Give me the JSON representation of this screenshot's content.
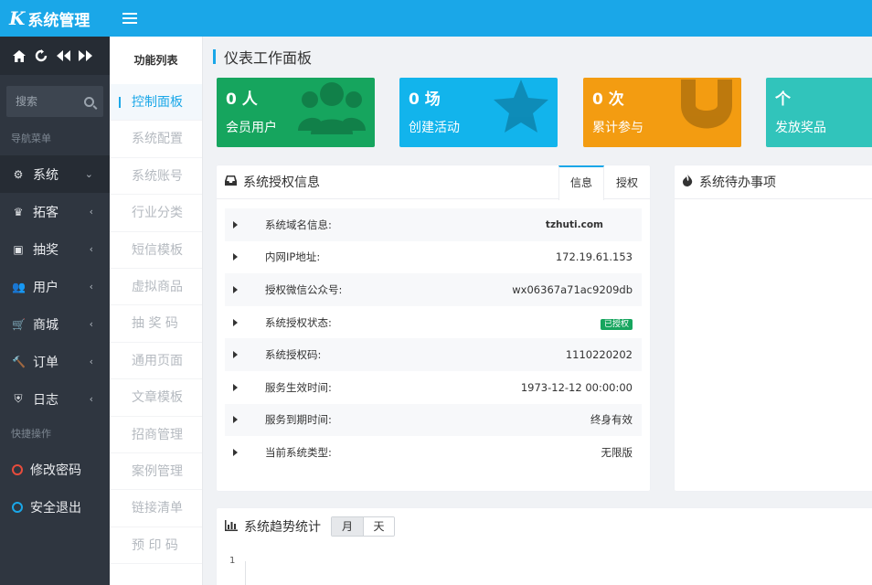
{
  "app": {
    "logo_letter": "K",
    "title": "系统管理"
  },
  "sidebar": {
    "search_placeholder": "搜索",
    "nav_section": "导航菜单",
    "items": [
      {
        "label": "系统",
        "icon": "gear-icon",
        "glyph": "⚙",
        "chev": "⌄"
      },
      {
        "label": "拓客",
        "icon": "trophy-icon",
        "glyph": "♛",
        "chev": "‹"
      },
      {
        "label": "抽奖",
        "icon": "gift-icon",
        "glyph": "▣",
        "chev": "‹"
      },
      {
        "label": "用户",
        "icon": "users-icon",
        "glyph": "👥",
        "chev": "‹"
      },
      {
        "label": "商城",
        "icon": "cart-icon",
        "glyph": "🛒",
        "chev": "‹"
      },
      {
        "label": "订单",
        "icon": "gavel-icon",
        "glyph": "🔨",
        "chev": "‹"
      },
      {
        "label": "日志",
        "icon": "shield-icon",
        "glyph": "⛨",
        "chev": "‹"
      }
    ],
    "quick_section": "快捷操作",
    "quick": [
      {
        "label": "修改密码",
        "color": "#e74c3c"
      },
      {
        "label": "安全退出",
        "color": "#1aa7e8"
      }
    ]
  },
  "funclist": {
    "title": "功能列表",
    "items": [
      "控制面板",
      "系统配置",
      "系统账号",
      "行业分类",
      "短信模板",
      "虚拟商品",
      "抽 奖 码",
      "通用页面",
      "文章模板",
      "招商管理",
      "案例管理",
      "链接清单",
      "预 印 码"
    ]
  },
  "main": {
    "page_title": "仪表工作面板",
    "stats": [
      {
        "num": "0 人",
        "label": "会员用户",
        "color": "#16a55e"
      },
      {
        "num": "0 场",
        "label": "创建活动",
        "color": "#12b4ec"
      },
      {
        "num": "0 次",
        "label": "累计参与",
        "color": "#f39c11"
      },
      {
        "num": "个",
        "label": "发放奖品",
        "color": "#31c4bb"
      }
    ],
    "auth_panel": {
      "title": "系统授权信息",
      "tabs": [
        "信息",
        "授权"
      ],
      "rows": [
        {
          "key": "系统域名信息:",
          "value": "tzhuti.com"
        },
        {
          "key": "内网IP地址:",
          "value": "172.19.61.153"
        },
        {
          "key": "授权微信公众号:",
          "value": "wx06367a71ac9209db"
        },
        {
          "key": "系统授权状态:",
          "value": "已授权"
        },
        {
          "key": "系统授权码:",
          "value": "1110220202"
        },
        {
          "key": "服务生效时间:",
          "value": "1973-12-12 00:00:00"
        },
        {
          "key": "服务到期时间:",
          "value": "终身有效"
        },
        {
          "key": "当前系统类型:",
          "value": "无限版"
        }
      ]
    },
    "todo_panel": {
      "title": "系统待办事项"
    },
    "trend_panel": {
      "title": "系统趋势统计",
      "segments": [
        "月",
        "天"
      ],
      "y_tick": "1"
    }
  }
}
